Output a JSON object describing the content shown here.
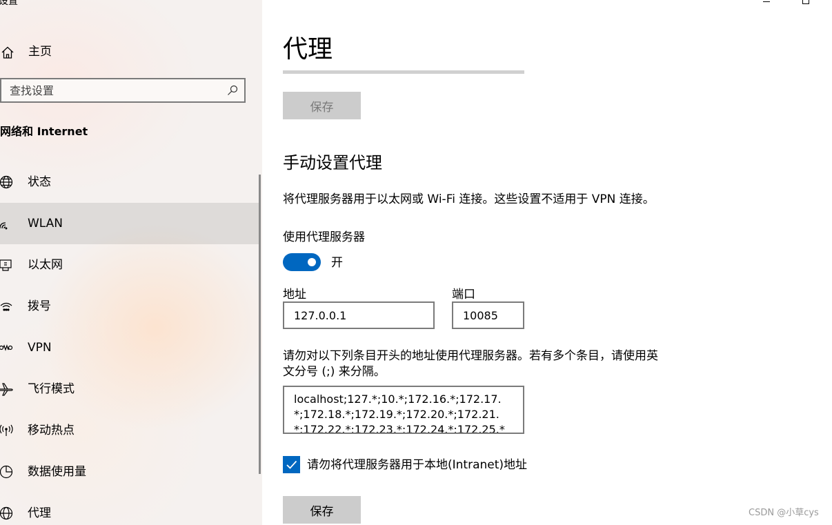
{
  "app": {
    "title": "设置"
  },
  "sidebar": {
    "home_label": "主页",
    "search_placeholder": "查找设置",
    "section_title": "网络和 Internet",
    "items": [
      {
        "label": "状态",
        "icon": "globe-icon",
        "selected": false
      },
      {
        "label": "WLAN",
        "icon": "wifi-icon",
        "selected": true
      },
      {
        "label": "以太网",
        "icon": "ethernet-icon",
        "selected": false
      },
      {
        "label": "拨号",
        "icon": "dialup-icon",
        "selected": false
      },
      {
        "label": "VPN",
        "icon": "vpn-icon",
        "selected": false
      },
      {
        "label": "飞行模式",
        "icon": "airplane-icon",
        "selected": false
      },
      {
        "label": "移动热点",
        "icon": "hotspot-icon",
        "selected": false
      },
      {
        "label": "数据使用量",
        "icon": "data-usage-icon",
        "selected": false
      },
      {
        "label": "代理",
        "icon": "proxy-globe-icon",
        "selected": false
      }
    ]
  },
  "main": {
    "page_title": "代理",
    "top_save_label": "保存",
    "manual_section_title": "手动设置代理",
    "manual_description": "将代理服务器用于以太网或 Wi-Fi 连接。这些设置不适用于 VPN 连接。",
    "use_proxy_label": "使用代理服务器",
    "toggle_state_label": "开",
    "toggle_on": true,
    "address_label": "地址",
    "address_value": "127.0.0.1",
    "port_label": "端口",
    "port_value": "10085",
    "exceptions_description_line1": "请勿对以下列条目开头的地址使用代理服务器。若有多个条目，请使用英",
    "exceptions_description_line2": "文分号 (;) 来分隔。",
    "exceptions_value": "localhost;127.*;10.*;172.16.*;172.17.*;172.18.*;172.19.*;172.20.*;172.21.*;172.22.*;172.23.*;172.24.*;172.25.*",
    "local_bypass_label": "请勿将代理服务器用于本地(Intranet)地址",
    "local_bypass_checked": true,
    "bottom_save_label": "保存"
  },
  "watermark": "CSDN @小草cys",
  "colors": {
    "accent": "#0067c0",
    "button_bg": "#cccccc",
    "sidebar_bg": "#f5f1ef"
  }
}
